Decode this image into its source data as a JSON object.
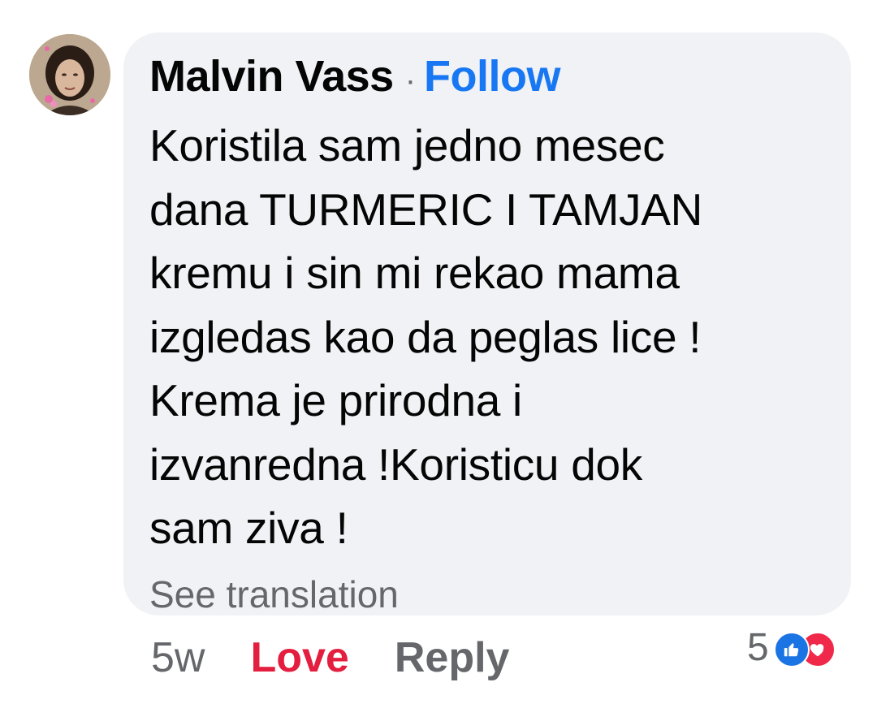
{
  "comment": {
    "author": "Malvin Vass",
    "separator": "·",
    "follow_label": "Follow",
    "text": "Koristila sam jedno mesec\ndana TURMERIC I TAMJAN\nkremu i sin mi rekao mama\nizgledas kao da peglas lice !\nKrema je prirodna i\nizvanredna !Koristicu dok\nsam ziva !",
    "translation_label": "See translation"
  },
  "actions": {
    "timestamp": "5w",
    "love_label": "Love",
    "reply_label": "Reply"
  },
  "reactions": {
    "count": "5",
    "icons": [
      "like-icon",
      "love-icon"
    ],
    "like_color": "#1b74e4",
    "love_color": "#f0284a"
  },
  "colors": {
    "bubble_background": "#f0f2f5",
    "follow_link": "#1877f2",
    "love_active": "#e41e3f",
    "secondary_text": "#65676b",
    "primary_text": "#050505"
  },
  "avatar": {
    "icon": "profile-photo"
  }
}
